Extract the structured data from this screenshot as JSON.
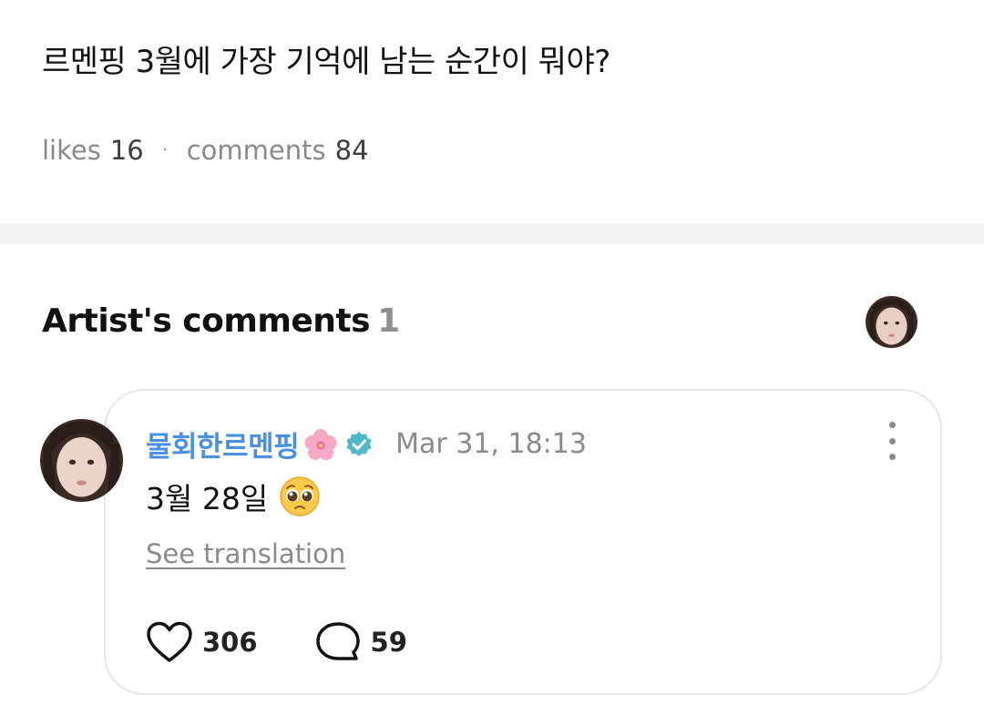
{
  "post": {
    "title": "르멘핑 3월에 가장 기억에 남는 순간이 뭐야?",
    "likes_label": "likes",
    "likes_count": "16",
    "separator": "·",
    "comments_label": "comments",
    "comments_count": "84"
  },
  "artist_comments": {
    "title": "Artist's comments",
    "count": "1",
    "avatar_icon": "artist-avatar"
  },
  "comment": {
    "author": "물회한르멘핑",
    "author_emoji": "cherry-blossom-icon",
    "verified_icon": "verified-badge-icon",
    "timestamp": "Mar 31, 18:13",
    "body": "3월 28일",
    "body_emoji": "pleading-face-emoji",
    "see_translation": "See translation",
    "like_count": "306",
    "reply_count": "59"
  },
  "colors": {
    "author_name": "#4a90e2",
    "verified_badge": "#4fb8c9",
    "muted_text": "#8a8a8a",
    "divider_band": "#f3f3f3",
    "card_border": "#e6e6e6"
  }
}
